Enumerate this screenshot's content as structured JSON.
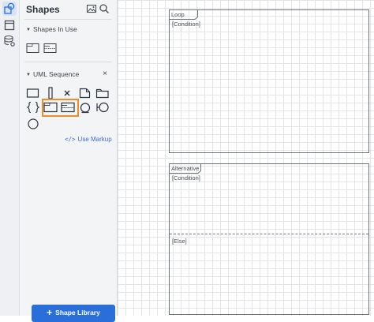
{
  "sidebar_rail": {
    "items": [
      {
        "icon": "shapes-icon",
        "active": true
      },
      {
        "icon": "page-icon",
        "active": false
      },
      {
        "icon": "database-icon",
        "active": false
      }
    ]
  },
  "panel": {
    "title": "Shapes",
    "tools": [
      "image-icon",
      "search-icon"
    ],
    "sections": [
      {
        "label": "Shapes In Use",
        "expanded": true
      },
      {
        "label": "UML Sequence",
        "expanded": true,
        "closable": true
      }
    ],
    "close_glyph": "×",
    "use_markup": {
      "code": "</>",
      "label": "Use Markup"
    },
    "shape_library": {
      "plus": "+",
      "label": "Shape Library"
    }
  },
  "canvas": {
    "frames": [
      {
        "tag": "Loop",
        "conditions": [
          "[Condition]"
        ]
      },
      {
        "tag": "Alternative",
        "conditions": [
          "[Condition]",
          "[Else]"
        ]
      }
    ]
  },
  "colors": {
    "accent": "#2a6fd9",
    "highlight": "#f28c28",
    "link": "#3b6fd6"
  }
}
